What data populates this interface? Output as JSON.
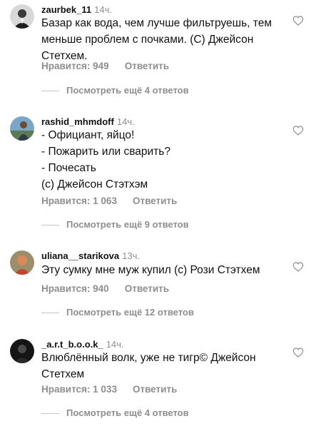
{
  "comments": [
    {
      "username": "zaurbek_11",
      "time": "14ч.",
      "lines": [
        "Базар как вода, чем лучше фильтруешь, тем",
        "меньше проблем с почками. (С) Джейсон",
        "Стетхем."
      ],
      "likes_label": "Нравится: 949",
      "reply_label": "Ответить",
      "more_label": "Посмотреть ещё 4 ответов"
    },
    {
      "username": "rashid_mhmdoff",
      "time": "14ч.",
      "lines": [
        "- Официант, яйцо!",
        "- Пожарить или сварить?",
        "- Почесать",
        "(с) Джейсон Стэтхэм"
      ],
      "likes_label": "Нравится: 1 063",
      "reply_label": "Ответить",
      "more_label": "Посмотреть ещё 9 ответов"
    },
    {
      "username": "uliana__starikova",
      "time": "13ч.",
      "lines": [
        "Эту сумку мне муж купил (с) Рози Стэтхем"
      ],
      "likes_label": "Нравится: 940",
      "reply_label": "Ответить",
      "more_label": "Посмотреть ещё 12 ответов"
    },
    {
      "username": "_a.r.t_b.o.o.k_",
      "time": "14ч.",
      "lines": [
        "Влюблённый волк, уже не тигр© Джейсон",
        "Стетхем"
      ],
      "likes_label": "Нравится: 1 033",
      "reply_label": "Ответить",
      "more_label": "Посмотреть ещё 4 ответов"
    }
  ]
}
